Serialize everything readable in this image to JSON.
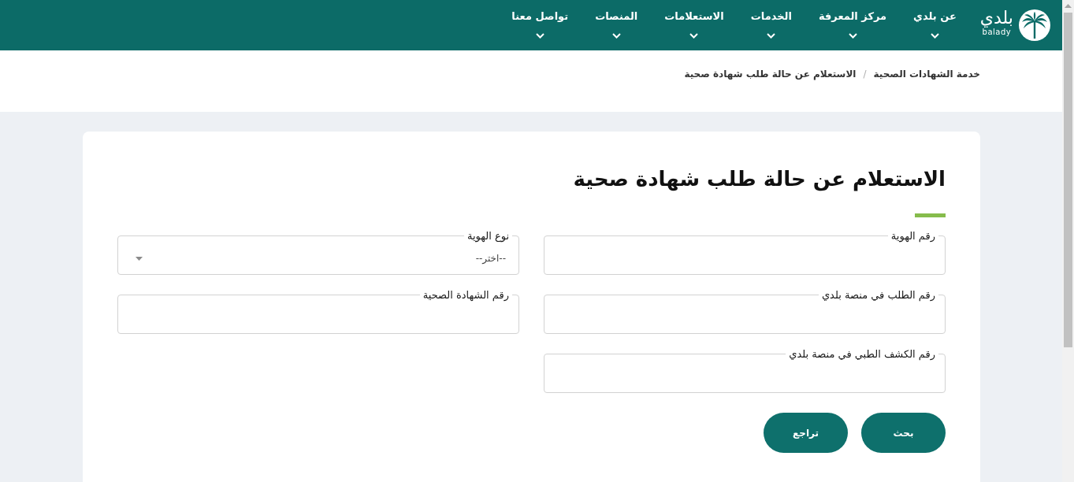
{
  "header": {
    "logo": {
      "name": "بلدي",
      "latin_name": "balady"
    },
    "nav": [
      {
        "label": "عن بلدي",
        "has_dropdown": true
      },
      {
        "label": "مركز المعرفة",
        "has_dropdown": true
      },
      {
        "label": "الخدمات",
        "has_dropdown": true
      },
      {
        "label": "الاستعلامات",
        "has_dropdown": true
      },
      {
        "label": "المنصات",
        "has_dropdown": true
      },
      {
        "label": "تواصل معنا",
        "has_dropdown": true
      }
    ]
  },
  "breadcrumb": {
    "items": [
      "خدمة الشهادات الصحية",
      "الاستعلام عن حالة طلب شهادة صحية"
    ],
    "separator": "/"
  },
  "form": {
    "title": "الاستعلام عن حالة طلب شهادة صحية",
    "fields": [
      {
        "kind": "text",
        "label": "رقم الهوية"
      },
      {
        "kind": "select",
        "label": "نوع الهوية",
        "placeholder": "--اختر--"
      },
      {
        "kind": "text",
        "label": "رقم الطلب في منصة بلدي"
      },
      {
        "kind": "text",
        "label": "رقم الشهادة الصحية"
      },
      {
        "kind": "text",
        "label": "رقم الكشف الطبي في منصة بلدي"
      }
    ],
    "buttons": [
      {
        "label": "بحث"
      },
      {
        "label": "تراجع"
      }
    ]
  }
}
